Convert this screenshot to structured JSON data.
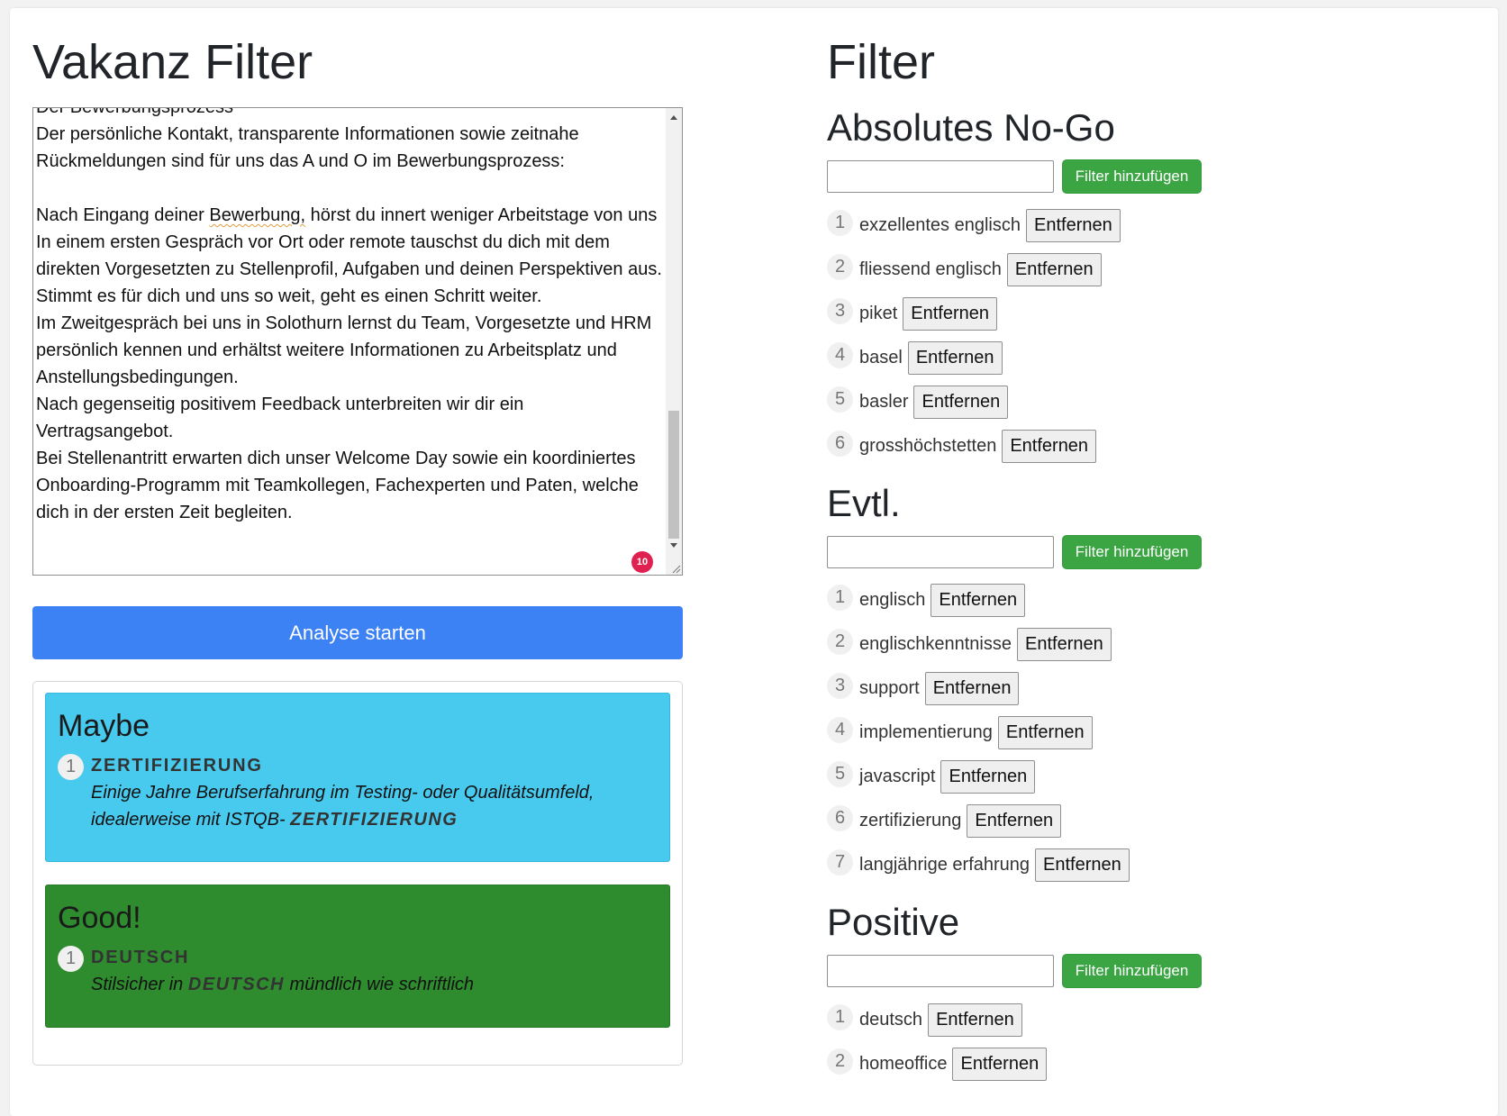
{
  "left": {
    "title": "Vakanz Filter",
    "textarea_lines": [
      "Der Bewerbungsprozess",
      "Der persönliche Kontakt, transparente Informationen sowie zeitnahe Rückmeldungen sind für uns das A und O im Bewerbungsprozess:",
      "",
      "Nach Eingang deiner Bewerbung, hörst du innert weniger Arbeitstage von uns",
      "In einem ersten Gespräch vor Ort oder remote tauschst du dich mit dem direkten Vorgesetzten zu Stellenprofil, Aufgaben und deinen Perspektiven aus.",
      "Stimmt es für dich und uns so weit, geht es einen Schritt weiter.",
      "Im Zweitgespräch bei uns in Solothurn lernst du Team, Vorgesetzte und HRM persönlich kennen und erhältst weitere Informationen zu Arbeitsplatz und Anstellungsbedingungen.",
      "Nach gegenseitig positivem Feedback unterbreiten wir dir ein Vertragsangebot.",
      "Bei Stellenantritt erwarten dich unser Welcome Day sowie ein koordiniertes Onboarding-Programm mit Teamkollegen, Fachexperten und Paten, welche dich in der ersten Zeit begleiten."
    ],
    "char_badge": "10",
    "analyse_button": "Analyse starten",
    "results": {
      "maybe": {
        "title": "Maybe",
        "items": [
          {
            "num": "1",
            "keyword": "ZERTIFIZIERUNG",
            "text_before": "Einige Jahre Berufserfahrung im Testing- oder Qualitätsumfeld, idealerweise mit ISTQB- ",
            "text_keyword": "ZERTIFIZIERUNG",
            "text_after": ""
          }
        ],
        "color": "#48caef"
      },
      "good": {
        "title": "Good!",
        "items": [
          {
            "num": "1",
            "keyword": "DEUTSCH",
            "text_before": "Stilsicher in ",
            "text_keyword": "DEUTSCH",
            "text_after": " mündlich wie schriftlich"
          }
        ],
        "color": "#2e8b2e"
      }
    }
  },
  "right": {
    "title": "Filter",
    "add_button_label": "Filter hinzufügen",
    "remove_button_label": "Entfernen",
    "sections": [
      {
        "title": "Absolutes No-Go",
        "input_value": "",
        "items": [
          "exzellentes englisch",
          "fliessend englisch",
          "piket",
          "basel",
          "basler",
          "grosshöchstetten"
        ]
      },
      {
        "title": "Evtl.",
        "input_value": "",
        "items": [
          "englisch",
          "englischkenntnisse",
          "support",
          "implementierung",
          "javascript",
          "zertifizierung",
          "langjährige erfahrung"
        ]
      },
      {
        "title": "Positive",
        "input_value": "",
        "items": [
          "deutsch",
          "homeoffice"
        ]
      }
    ]
  },
  "colors": {
    "primary_button": "#3d82f5",
    "success_button": "#3ba543",
    "badge": "#e02050"
  }
}
